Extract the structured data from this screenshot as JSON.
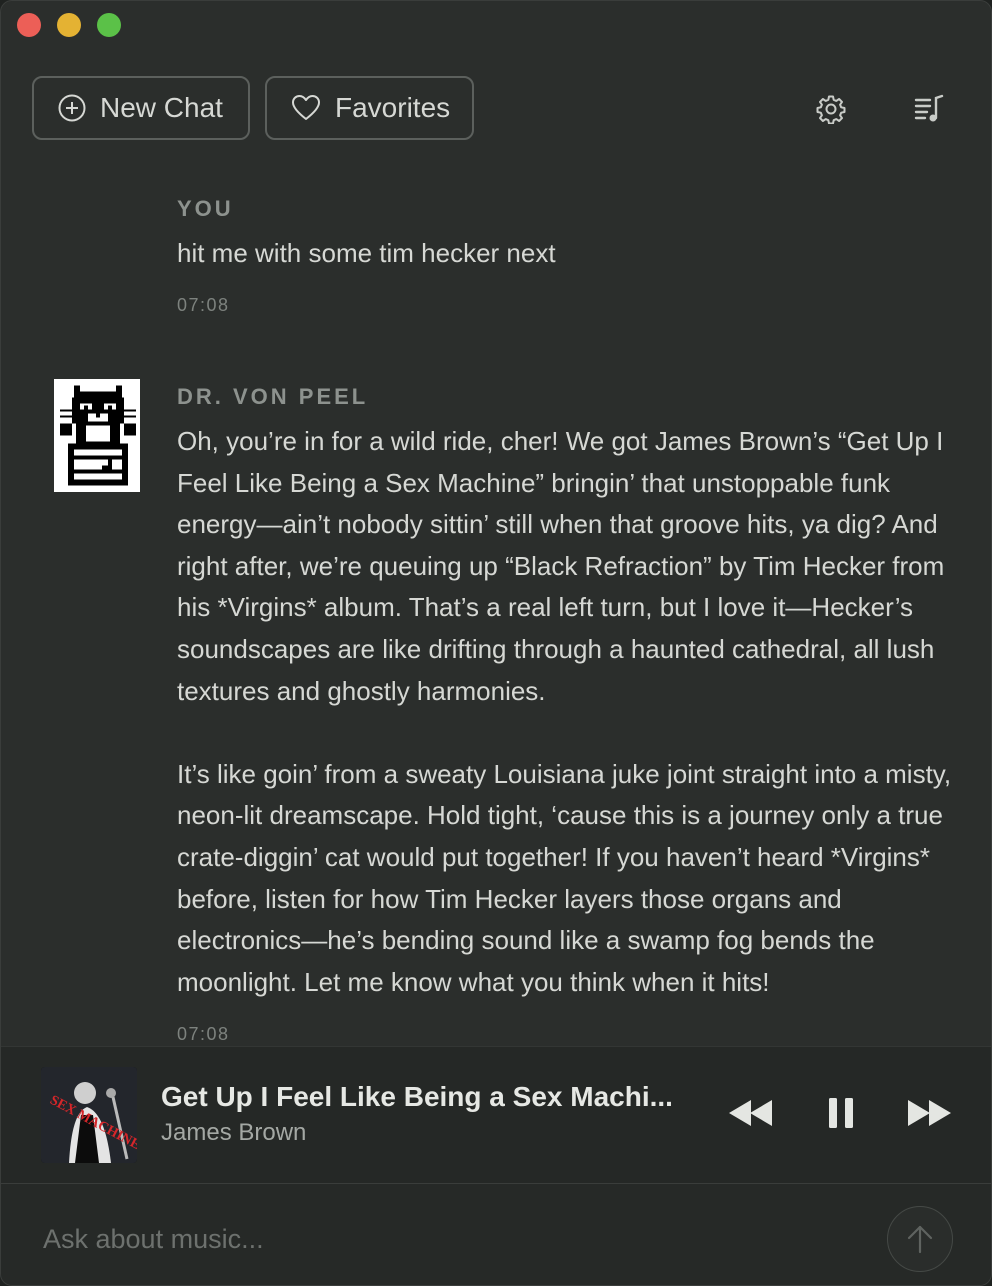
{
  "toolbar": {
    "new_chat_label": "New Chat",
    "favorites_label": "Favorites",
    "settings_icon": "gear-icon",
    "playlist_icon": "playlist-music-icon"
  },
  "messages": [
    {
      "sender": "YOU",
      "text": "hit me with some tim hecker next",
      "time": "07:08"
    },
    {
      "sender": "DR. VON PEEL",
      "paragraphs": [
        "Oh, you’re in for a wild ride, cher! We got James Brown’s “Get Up I Feel Like Being a Sex Machine” bringin’ that unstoppable funk energy—ain’t nobody sittin’ still when that groove hits, ya dig? And right after, we’re queuing up “Black Refraction” by Tim Hecker from his *Virgins* album. That’s a real left turn, but I love it—Hecker’s soundscapes are like drifting through a haunted cathedral, all lush textures and ghostly harmonies.",
        "It’s like goin’ from a sweaty Louisiana juke joint straight into a misty, neon-lit dreamscape. Hold tight, ‘cause this is a journey only a true crate-diggin’ cat would put together! If you haven’t heard *Virgins* before, listen for how Tim Hecker layers those organs and electronics—he’s bending sound like a swamp fog bends the moonlight. Let me know what you think when it hits!"
      ],
      "time": "07:08"
    }
  ],
  "player": {
    "title": "Get Up I Feel Like Being a Sex Machi...",
    "artist": "James Brown",
    "album_art_text": "SEX MACHINE",
    "state": "playing"
  },
  "input": {
    "placeholder": "Ask about music..."
  },
  "colors": {
    "background": "#2b2e2c",
    "text": "#d6d8d4",
    "muted": "#8d928e",
    "close": "#ec5f57",
    "minimize": "#e4b233",
    "zoom": "#5bc148"
  }
}
